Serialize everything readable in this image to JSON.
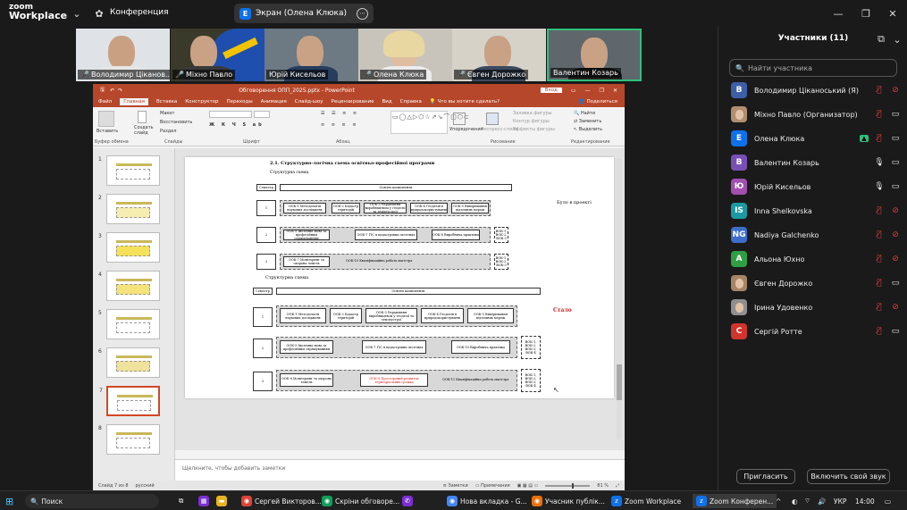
{
  "zoom": {
    "logo_line1": "zoom",
    "logo_line2": "Workplace",
    "meeting_label": "Конференция",
    "share_label": "Экран (Олена Клюка)",
    "share_icon_letter": "E"
  },
  "video_tiles": [
    {
      "name": "Володимир Ціканов..."
    },
    {
      "name": "Міхно Павло"
    },
    {
      "name": "Юрій Кисельов"
    },
    {
      "name": "Олена Клюка"
    },
    {
      "name": "Євген Дорожко"
    },
    {
      "name": "Валентин Козарь"
    }
  ],
  "ppt": {
    "window_title": "Обговорення ОПП_2025.pptx - PowerPoint",
    "sign_in": "Вход",
    "tabs": [
      "Файл",
      "Главная",
      "Вставка",
      "Конструктор",
      "Переходы",
      "Анимация",
      "Слайд-шоу",
      "Рецензирование",
      "Вид",
      "Справка",
      "Что вы хотите сделать?",
      "Поделиться"
    ],
    "ribbon_groups": [
      "Буфер обмена",
      "Слайды",
      "Шрифт",
      "Абзац",
      "Рисование",
      "Редактирование"
    ],
    "ribbon_paste": "Вставить",
    "ribbon_create": "Создать слайд",
    "ribbon_layout": "Макет",
    "ribbon_restore": "Восстановить",
    "ribbon_section": "Раздел",
    "ribbon_arrange": "Упорядочение",
    "ribbon_styles": "Экспресс-стили",
    "ribbon_fill": "Заливка фигуры",
    "ribbon_outline": "Контур фигуры",
    "ribbon_effects": "Эффекты фигуры",
    "ribbon_find": "Найти",
    "ribbon_replace": "Заменить",
    "ribbon_select": "Выделить",
    "slide_numbers": [
      "1",
      "2",
      "3",
      "4",
      "5",
      "6",
      "7",
      "8"
    ],
    "notes_placeholder": "Щелкните, чтобы добавить заметки",
    "status_slide": "Слайд 7 из 8",
    "status_lang": "русский",
    "status_notes": "Заметки",
    "status_comments": "Примечания",
    "status_zoom": "81 %"
  },
  "slide": {
    "heading": "2.1. Структурно-логічна схема освітньо-професійної програми",
    "sub_old": "Структурна схема",
    "sub_new": "Структурна схема",
    "semester_label": "Семестр",
    "core_label": "Освітні компоненти",
    "was_label": "Було в проекті",
    "now_label": "Стало",
    "old_row1": [
      "ООК-1 Методологія наукових досліджень",
      "ООК-2 Кадастр територій",
      "ООК-3 Управління виробництвом у геодезії та землеустрої",
      "ООК-4 Геодезія в природокористуванні",
      "ООК-5 Вимірювання підземних мереж"
    ],
    "old_row2": [
      "ООК-5 Іноземна мова за професійним спрямуванням",
      "ООК-7 ГІС в кадастрових системах",
      "ООК-8 Виробнича практика"
    ],
    "old_row3": [
      "ООК-7 Моніторинг та охорона земель",
      "ООК-10 Кваліфікаційна робота магістра"
    ],
    "new_row1": [
      "ООК-1 Методологія наукових досліджень",
      "ООК-2 Кадастр територій",
      "ООК-3 Управління виробництвом у геодезії та землеустрої",
      "ООК-4 Геодезія в природокористуванні",
      "ООК-5 Вимірювання підземних мереж"
    ],
    "new_row2": [
      "ООК-5 Іноземна мова за професійним спрямуванням",
      "ООК-7 ГІС в кадастрових системах",
      "ООК-10 Виробнича практика"
    ],
    "new_row3": [
      "ООК-8 Моніторинг та охорона земель",
      "ООК-9 Просторовий розвиток територіальних громад",
      "ООК-11 Кваліфікаційна робота магістра"
    ],
    "vok_label": "ВОК-1, ВОК-2, ВОК-3",
    "vok_label2": "ВОК-1, ВОК-2, ВОК-3, ВОК-4"
  },
  "participants": {
    "title": "Участники (11)",
    "search_placeholder": "Найти участника",
    "list": [
      {
        "initial": "В",
        "name": "Володимир Ціканоський (Я)",
        "color": "#3d5fa8",
        "photo": false,
        "mic": "muted",
        "cam": "off"
      },
      {
        "initial": "",
        "name": "Міхно Павло (Организатор)",
        "color": "#b28f70",
        "photo": true,
        "mic": "muted",
        "cam": "on"
      },
      {
        "initial": "E",
        "name": "Олена Клюка",
        "color": "#0e71eb",
        "photo": false,
        "mic": "muted",
        "cam": "on"
      },
      {
        "initial": "В",
        "name": "Валентин Козарь",
        "color": "#7a4fb5",
        "photo": false,
        "mic": "on",
        "cam": "on"
      },
      {
        "initial": "Ю",
        "name": "Юрій Кисельов",
        "color": "#a24fb0",
        "photo": false,
        "mic": "on",
        "cam": "on"
      },
      {
        "initial": "IS",
        "name": "Inna Shelkovska",
        "color": "#1b9aa3",
        "photo": false,
        "mic": "muted",
        "cam": "off"
      },
      {
        "initial": "NG",
        "name": "Nadiya Galchenko",
        "color": "#3d6dc9",
        "photo": false,
        "mic": "muted",
        "cam": "off"
      },
      {
        "initial": "А",
        "name": "Альона Юхно",
        "color": "#2f9e44",
        "photo": false,
        "mic": "muted",
        "cam": "off"
      },
      {
        "initial": "",
        "name": "Євген Дорожко",
        "color": "#a88466",
        "photo": true,
        "mic": "muted",
        "cam": "on"
      },
      {
        "initial": "",
        "name": "Ірина Удовенко",
        "color": "#8f8f8f",
        "photo": true,
        "mic": "muted",
        "cam": "off"
      },
      {
        "initial": "С",
        "name": "Сергій Ротте",
        "color": "#d0342c",
        "photo": false,
        "mic": "muted",
        "cam": "on"
      }
    ],
    "invite_label": "Пригласить",
    "unmute_label": "Включить свой звук"
  },
  "taskbar": {
    "search": "Поиск",
    "apps": [
      "Сергей Викторов...",
      "Скріни обговоре...",
      "Нова вкладка - G...",
      "Учасник публік...",
      "Zoom Workplace",
      "Zoom Конферен..."
    ],
    "lang": "УКР",
    "time": "14:00"
  }
}
